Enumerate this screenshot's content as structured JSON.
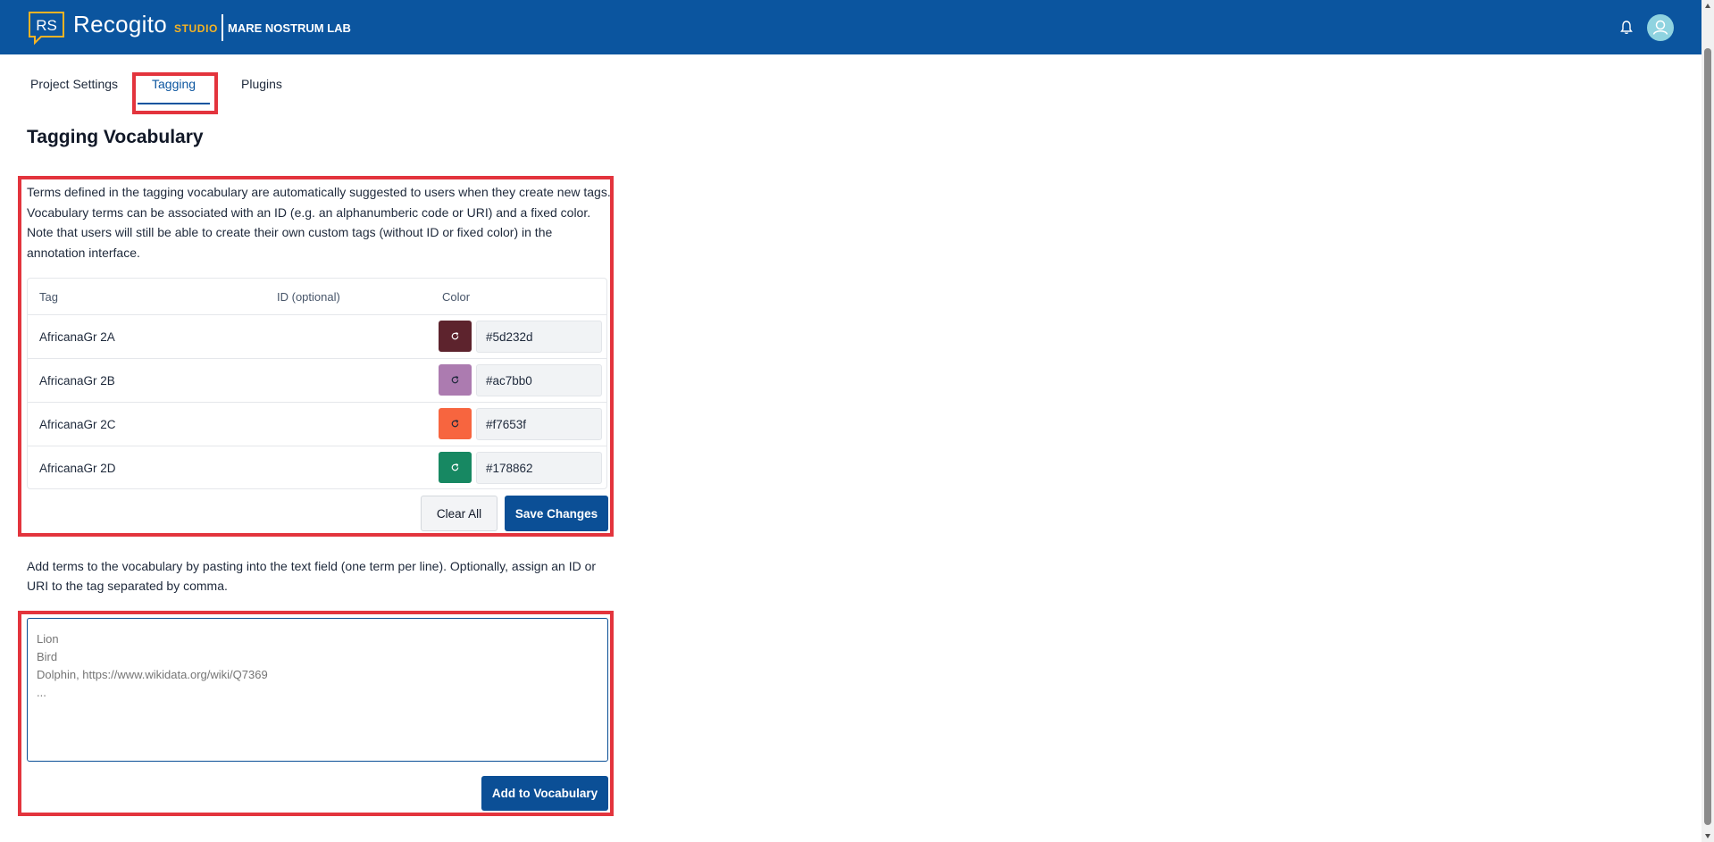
{
  "header": {
    "logo_text": "RS",
    "brand": "Recogito",
    "brand_suffix": "STUDIO",
    "project_name": "MARE NOSTRUM LAB",
    "icons": [
      "bell-icon",
      "user-avatar-icon"
    ]
  },
  "tabs": [
    {
      "label": "Project Settings",
      "active": false
    },
    {
      "label": "Tagging",
      "active": true
    },
    {
      "label": "Plugins",
      "active": false
    }
  ],
  "page": {
    "title": "Tagging Vocabulary",
    "description": "Terms defined in the tagging vocabulary are automatically suggested to users when they create new tags. Vocabulary terms can be associated with an ID (e.g. an alphanumberic code or URI) and a fixed color. Note that users will still be able to create their own custom tags (without ID or fixed color) in the annotation interface."
  },
  "table": {
    "headers": {
      "tag": "Tag",
      "id": "ID (optional)",
      "color": "Color"
    },
    "rows": [
      {
        "tag": "AfricanaGr 2A",
        "id": "",
        "color": "#5d232d"
      },
      {
        "tag": "AfricanaGr 2B",
        "id": "",
        "color": "#ac7bb0"
      },
      {
        "tag": "AfricanaGr 2C",
        "id": "",
        "color": "#f7653f"
      },
      {
        "tag": "AfricanaGr 2D",
        "id": "",
        "color": "#178862"
      }
    ],
    "clear_label": "Clear All",
    "save_label": "Save Changes"
  },
  "add_terms": {
    "description": "Add terms to the vocabulary by pasting into the text field (one term per line). Optionally, assign an ID or URI to the tag separated by comma.",
    "placeholder": "Lion\nBird\nDolphin, https://www.wikidata.org/wiki/Q7369\n...",
    "value": "",
    "button_label": "Add to Vocabulary"
  },
  "colors": {
    "header_bg": "#0b559f",
    "primary": "#0b4f96",
    "accent": "#f5b324",
    "highlight": "#e3343d"
  }
}
